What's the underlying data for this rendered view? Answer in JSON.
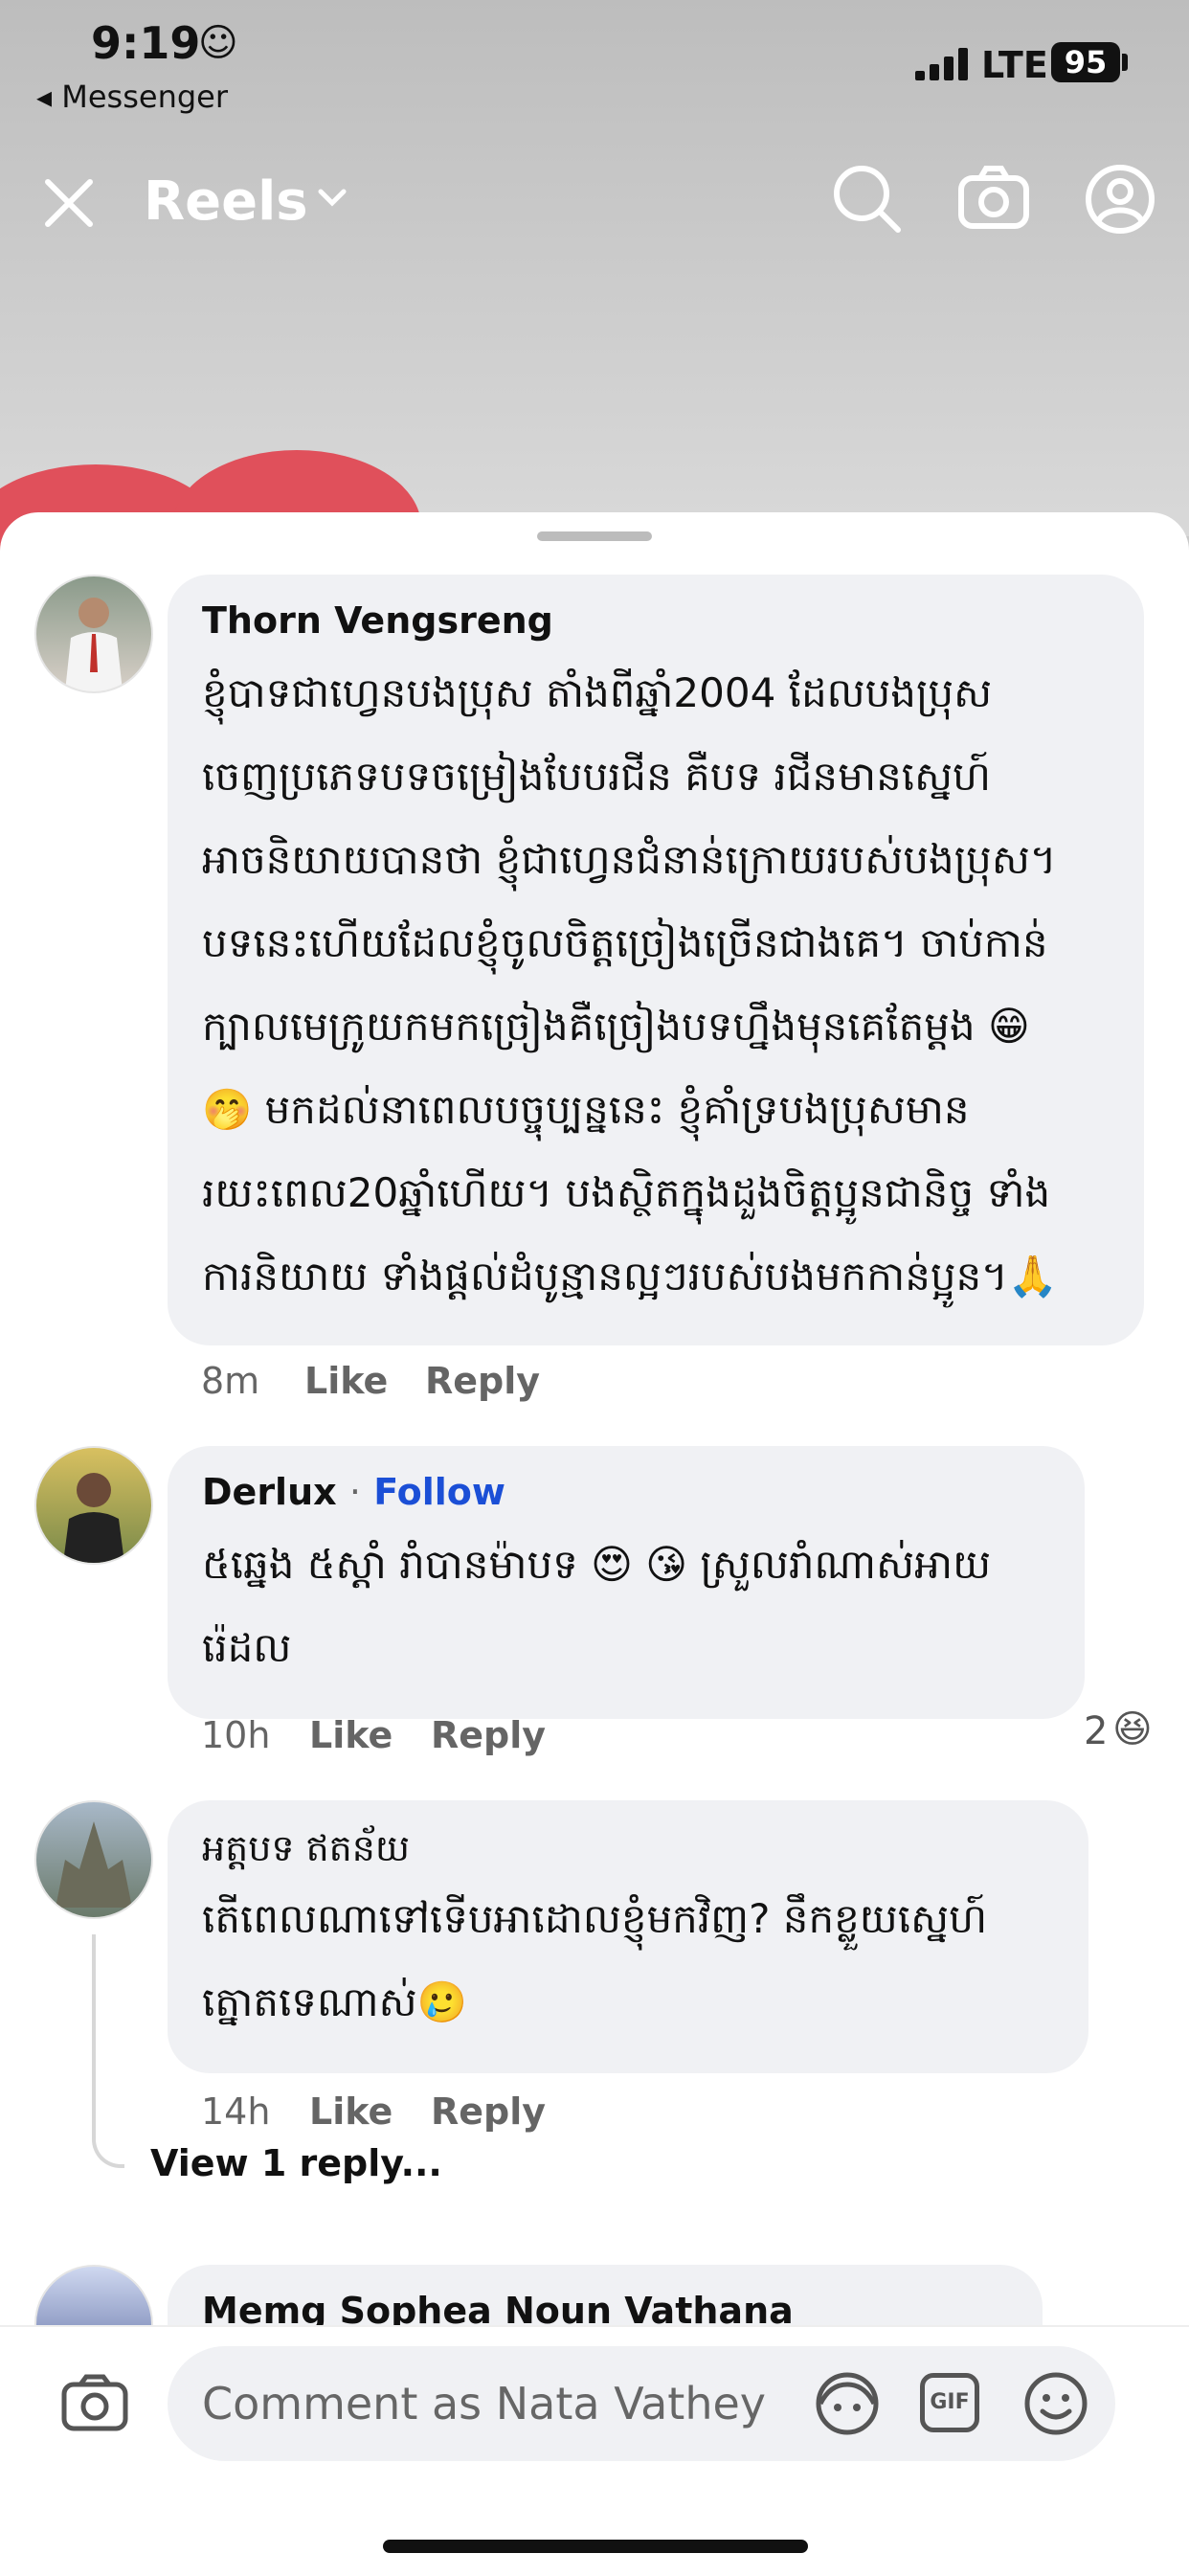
{
  "status": {
    "time": "9:19",
    "time_emoji": "☺",
    "back_app": "◂ Messenger",
    "network": "LTE",
    "battery": "95"
  },
  "topnav": {
    "title": "Reels"
  },
  "comments": [
    {
      "author": "Thorn Vengsreng",
      "lines": [
        "ខ្ញុំបាទជាហ្វេនបងប្រុស តាំងពីឆ្នាំ2004 ដែលបងប្រុស",
        "ចេញប្រភេទបទចម្រៀងបែបរជីន គឺបទ រជីនមានស្នេហ៍",
        "អាចនិយាយបានថា ខ្ញុំជាហ្វេនជំនាន់ក្រោយរបស់បងប្រុស។",
        "បទនេះហើយដែលខ្ញុំចូលចិត្តច្រៀងច្រើនជាងគេ។ ចាប់កាន់",
        "ក្បាលមេក្រូយកមកច្រៀងគឺច្រៀងបទហ្នឹងមុនគេតែម្តង 😁",
        "🤭 មកដល់នាពេលបច្ចុប្បន្ននេះ ខ្ញុំគាំទ្របងប្រុសមាន",
        "រយះពេល20ឆ្នាំហើយ។ បងស្ថិតក្នុងដួងចិត្តប្អូនជានិច្ច ទាំង",
        "ការនិយាយ ទាំងផ្តល់ដំបូន្មានល្អៗរបស់បងមកកាន់ប្អូន។🙏"
      ],
      "time": "8m",
      "like": "Like",
      "reply": "Reply"
    },
    {
      "author": "Derlux",
      "dot": "·",
      "follow": "Follow",
      "lines": [
        "៥ឆ្នេង ៥ស្តាំ រាំបានម៉ាបទ 😍 😘 ស្រួលរាំណាស់អាយ",
        "រ៉េដល"
      ],
      "time": "10h",
      "like": "Like",
      "reply": "Reply",
      "reaction_count": "2",
      "reaction_emoji": "😆"
    },
    {
      "author": "អត្តបទ ឥតន័យ",
      "lines": [
        "តើពេលណាទៅទើបអាដោលខ្ញុំមកវិញ? នឹកខ្លួយស្នេហ៍",
        "ត្នោតទេណាស់🥲"
      ],
      "time": "14h",
      "like": "Like",
      "reply": "Reply",
      "view_replies": "View 1 reply..."
    },
    {
      "author": "Memg Sophea Noun Vathana"
    }
  ],
  "composer": {
    "placeholder": "Comment as Nata Vathey",
    "gif": "GIF"
  }
}
